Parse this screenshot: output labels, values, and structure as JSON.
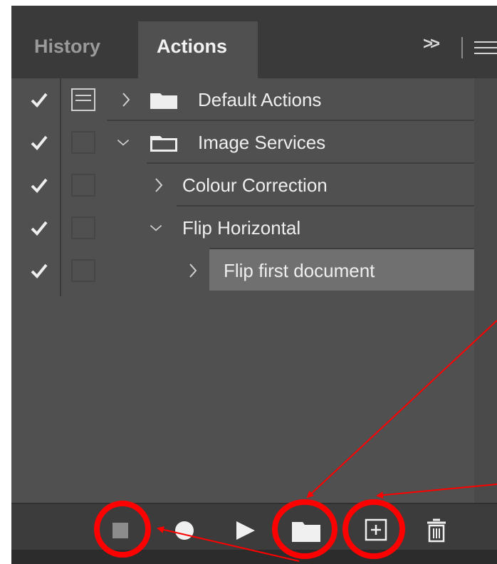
{
  "tabs": [
    {
      "label": "History",
      "active": false
    },
    {
      "label": "Actions",
      "active": true
    }
  ],
  "header": {
    "flyout_label": ">>"
  },
  "actions": [
    {
      "label": "Default Actions",
      "type": "set",
      "expanded": false,
      "checked": true,
      "dialog_shown": true
    },
    {
      "label": "Image Services",
      "type": "set",
      "expanded": true,
      "checked": true,
      "dialog_shown": false
    },
    {
      "label": "Colour Correction",
      "type": "action",
      "expanded": false,
      "checked": true,
      "dialog_shown": false
    },
    {
      "label": "Flip Horizontal",
      "type": "action",
      "expanded": true,
      "checked": true,
      "dialog_shown": false
    },
    {
      "label": "Flip first document",
      "type": "step",
      "expanded": false,
      "checked": true,
      "dialog_shown": false,
      "selected": true
    }
  ],
  "toolbar": {
    "buttons": [
      "stop-recording",
      "begin-recording",
      "play-selection",
      "create-new-set",
      "create-new-action",
      "delete"
    ]
  },
  "colors": {
    "panel_bg": "#505050",
    "tab_bar_bg": "#3a3a3a",
    "selection": "#707070",
    "annotation": "#ff0000"
  }
}
